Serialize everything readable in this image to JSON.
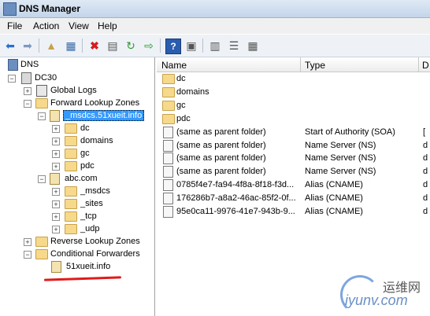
{
  "window": {
    "title": "DNS Manager"
  },
  "menu": [
    "File",
    "Action",
    "View",
    "Help"
  ],
  "toolbar": {
    "buttons": [
      "back-icon",
      "forward-icon",
      "up-folder-icon",
      "show-hide-tree-icon",
      "delete-icon",
      "properties-icon",
      "refresh-icon",
      "export-icon",
      "help-icon",
      "action-pane-icon",
      "log-icon",
      "list-view-icon",
      "details-view-icon"
    ]
  },
  "tree": {
    "root": "DNS",
    "server": "DC30",
    "global_logs": "Global Logs",
    "forward_zones": "Forward Lookup Zones",
    "zone1": "_msdcs.51xueit.info",
    "zone1_children": [
      "dc",
      "domains",
      "gc",
      "pdc"
    ],
    "zone2": "abc.com",
    "zone2_children": [
      "_msdcs",
      "_sites",
      "_tcp",
      "_udp"
    ],
    "reverse_zones": "Reverse Lookup Zones",
    "conditional": "Conditional Forwarders",
    "conditional_child": "51xueit.info"
  },
  "list": {
    "columns": [
      "Name",
      "Type",
      "D"
    ],
    "rows": [
      {
        "name": "dc",
        "type": "",
        "data": "",
        "icon": "folder"
      },
      {
        "name": "domains",
        "type": "",
        "data": "",
        "icon": "folder"
      },
      {
        "name": "gc",
        "type": "",
        "data": "",
        "icon": "folder"
      },
      {
        "name": "pdc",
        "type": "",
        "data": "",
        "icon": "folder"
      },
      {
        "name": "(same as parent folder)",
        "type": "Start of Authority (SOA)",
        "data": "[",
        "icon": "record"
      },
      {
        "name": "(same as parent folder)",
        "type": "Name Server (NS)",
        "data": "d",
        "icon": "record"
      },
      {
        "name": "(same as parent folder)",
        "type": "Name Server (NS)",
        "data": "d",
        "icon": "record"
      },
      {
        "name": "(same as parent folder)",
        "type": "Name Server (NS)",
        "data": "d",
        "icon": "record"
      },
      {
        "name": "0785f4e7-fa94-4f8a-8f18-f3d...",
        "type": "Alias (CNAME)",
        "data": "d",
        "icon": "record"
      },
      {
        "name": "176286b7-a8a2-46ac-85f2-0f...",
        "type": "Alias (CNAME)",
        "data": "d",
        "icon": "record"
      },
      {
        "name": "95e0ca11-9976-41e7-943b-9...",
        "type": "Alias (CNAME)",
        "data": "d",
        "icon": "record"
      }
    ]
  },
  "watermark": {
    "top": "运维网",
    "bottom": "iyunv.com"
  },
  "colors": {
    "selection": "#3399ff",
    "underline": "#e01b1b"
  }
}
